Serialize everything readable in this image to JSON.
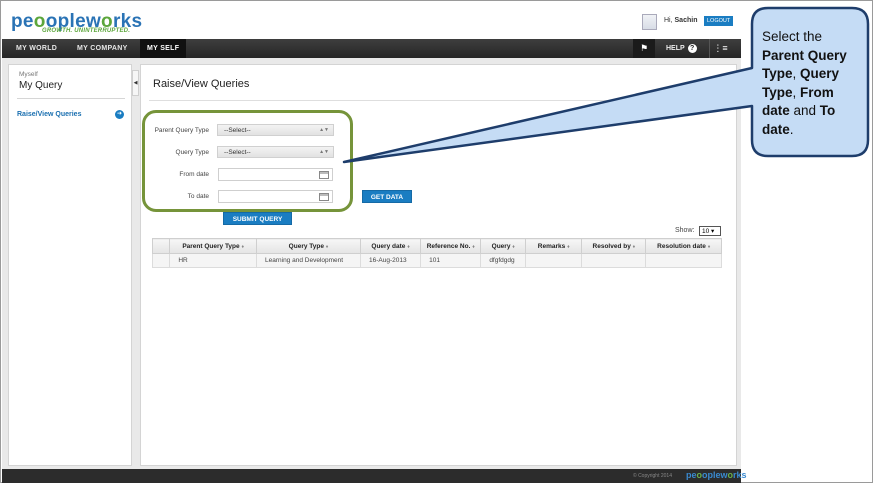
{
  "header": {
    "logo_main": "peopleworks",
    "logo_left": "pe",
    "logo_mid": "ople",
    "logo_w": "w",
    "logo_end": "rks",
    "logo_o": "o",
    "tagline": "GROWTH. UNINTERRUPTED.",
    "greeting_prefix": "Hi,",
    "user_name": "Sachin",
    "logout_label": "LOGOUT"
  },
  "nav": {
    "items": [
      {
        "label": "MY WORLD"
      },
      {
        "label": "MY COMPANY"
      },
      {
        "label": "MY SELF"
      }
    ],
    "help_label": "HELP"
  },
  "sidebar": {
    "breadcrumb": "Myself",
    "title": "My Query",
    "items": [
      {
        "label": "Raise/View Queries"
      }
    ]
  },
  "main": {
    "title": "Raise/View Queries",
    "form": {
      "parent_query_type_label": "Parent Query Type",
      "parent_query_type_value": "--Select--",
      "query_type_label": "Query Type",
      "query_type_value": "--Select--",
      "from_date_label": "From date",
      "to_date_label": "To date",
      "get_data_label": "GET DATA",
      "submit_label": "SUBMIT QUERY"
    },
    "show_label": "Show:",
    "show_value": "10",
    "table": {
      "columns": [
        "Parent Query Type",
        "Query Type",
        "Query date",
        "Reference No.",
        "Query",
        "Remarks",
        "Resolved by",
        "Resolution date"
      ],
      "rows": [
        {
          "parent_query_type": "HR",
          "query_type": "Learning and Development",
          "query_date": "16-Aug-2013",
          "reference_no": "101",
          "query": "dfgfdgdg",
          "remarks": "",
          "resolved_by": "",
          "resolution_date": ""
        }
      ]
    }
  },
  "footer": {
    "copyright": "© Copyright 2014"
  },
  "callout": {
    "text_1": "Select the ",
    "bold_1": "Parent Query Type",
    "text_2": ", ",
    "bold_2": "Query Type",
    "text_3": ", ",
    "bold_3": "From date",
    "text_4": " and ",
    "bold_4": "To date",
    "text_5": "."
  },
  "colors": {
    "brand_blue": "#1a7dc2",
    "highlight_green": "#76943a",
    "callout_fill": "#c5dcf5",
    "callout_border": "#1e3d6b"
  }
}
